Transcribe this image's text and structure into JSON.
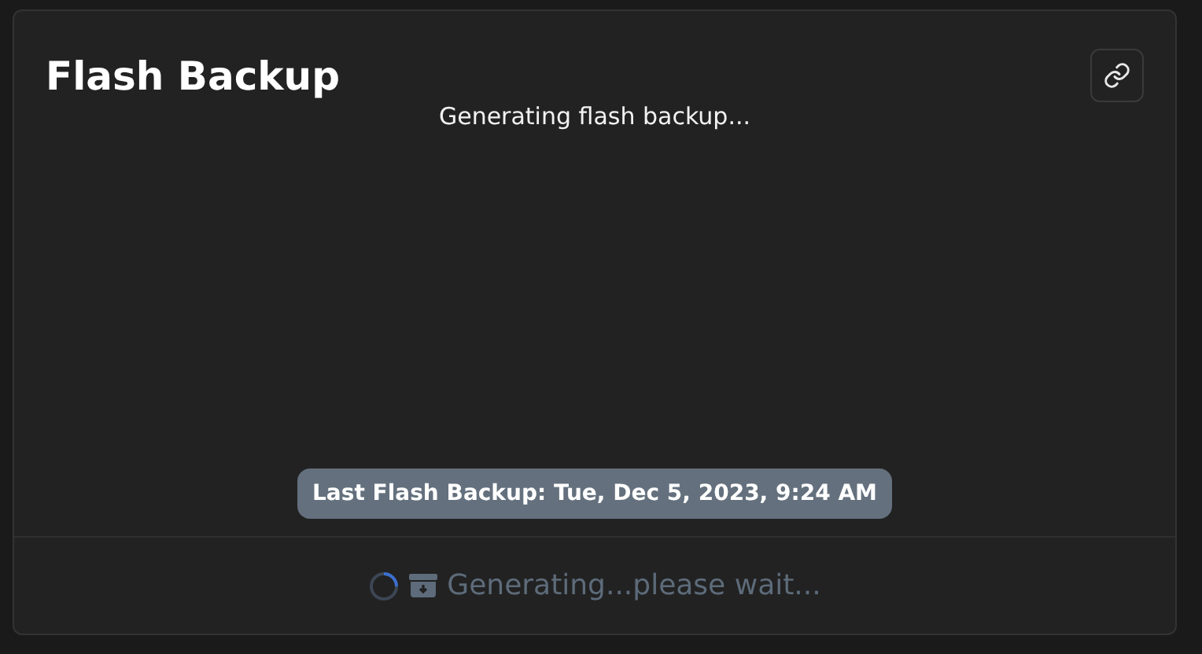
{
  "card": {
    "title": "Flash Backup",
    "status": "Generating flash backup...",
    "last_backup": "Last Flash Backup: Tue, Dec 5, 2023, 9:24 AM"
  },
  "action_button": {
    "label": "Generating...please wait...",
    "busy": true,
    "disabled": true
  }
}
